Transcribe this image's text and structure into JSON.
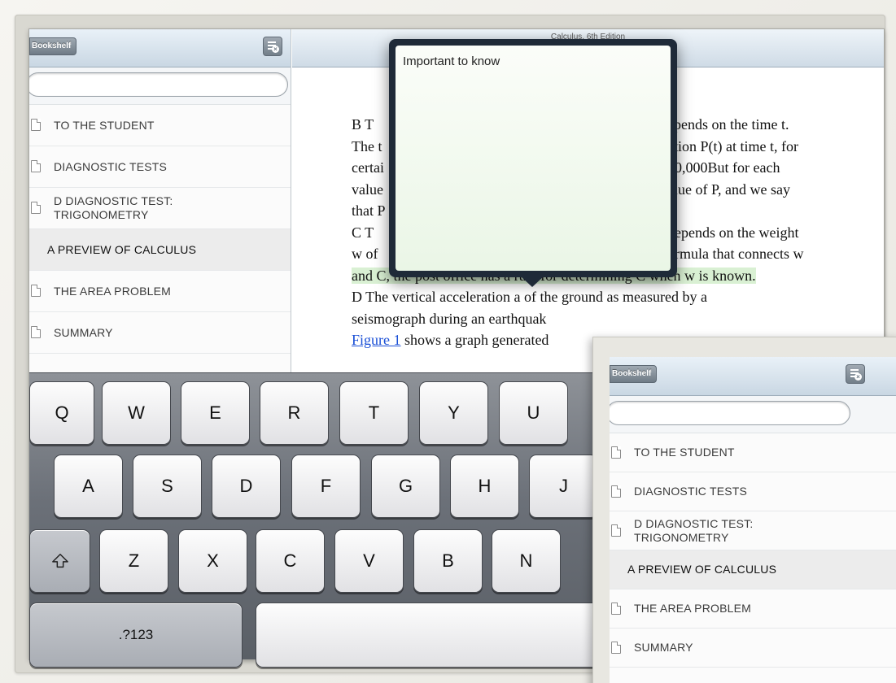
{
  "sidebar": {
    "bookshelf_label": "Bookshelf",
    "menu_icon": "list-settings-icon",
    "search": {
      "placeholder": ""
    },
    "items": [
      {
        "label": "TO THE STUDENT"
      },
      {
        "label": "DIAGNOSTIC TESTS"
      },
      {
        "label": "D DIAGNOSTIC TEST: TRIGONOMETRY"
      },
      {
        "label": "A PREVIEW OF CALCULUS",
        "active": true
      },
      {
        "label": "THE AREA PROBLEM"
      },
      {
        "label": "SUMMARY"
      }
    ]
  },
  "reader": {
    "title": "Calculus, 6th Edition",
    "lines": [
      "B   T",
      "The t",
      "certai",
      "value",
      "that P"
    ],
    "right_fragments": [
      "epends on the time t.",
      "ation P(t) at time t, for",
      "00,000But for each",
      "alue of P, and we say"
    ],
    "c_line_left": "C   T",
    "c_line_right": "depends on the weight",
    "w_line_left": "w of",
    "w_line_right": "ormula that connects w",
    "line_and": "and C, the post office has a rule for determining C when w is known.",
    "line_d": "D   The vertical acceleration a of the ground as measured by a",
    "line_seis": "seismograph during an earthquak",
    "fig_link": "Figure 1",
    "fig_rest": " shows a graph generated"
  },
  "popover": {
    "text": "Important to know"
  },
  "keyboard": {
    "row1": [
      "Q",
      "W",
      "E",
      "R",
      "T",
      "Y",
      "U"
    ],
    "row2": [
      "A",
      "S",
      "D",
      "F",
      "G",
      "H",
      "J"
    ],
    "row3": [
      "Z",
      "X",
      "C",
      "V",
      "B",
      "N"
    ],
    "shift_icon": "shift-icon",
    "numbers_label": ".?123"
  },
  "inset": {
    "bookshelf_label": "Bookshelf",
    "items": [
      {
        "label": "TO THE STUDENT"
      },
      {
        "label": "DIAGNOSTIC TESTS"
      },
      {
        "label": "D DIAGNOSTIC TEST: TRIGONOMETRY"
      },
      {
        "label": "A PREVIEW OF CALCULUS",
        "active": true
      },
      {
        "label": "THE AREA PROBLEM"
      },
      {
        "label": "SUMMARY"
      }
    ]
  }
}
